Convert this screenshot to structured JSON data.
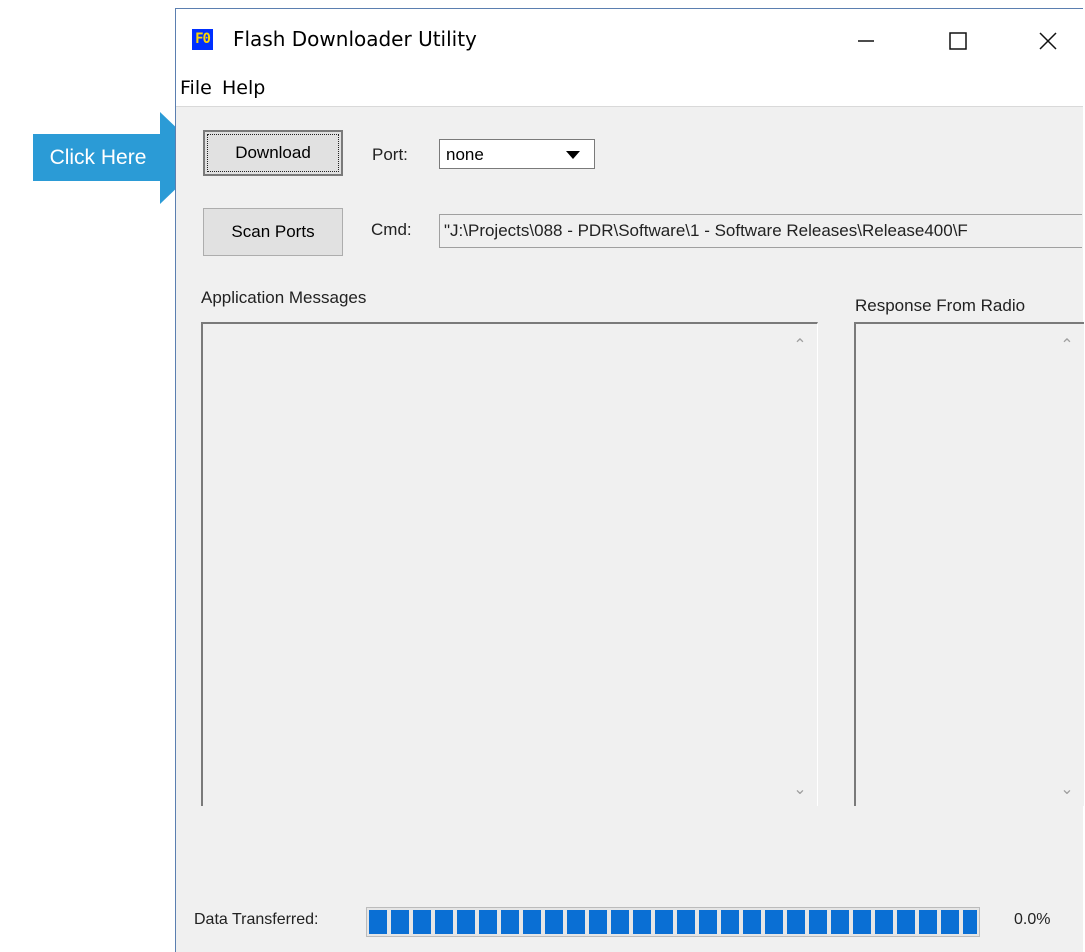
{
  "callout": {
    "label": "Click Here",
    "color": "#2b9bd6"
  },
  "window": {
    "title": "Flash Downloader Utility",
    "icon_glyph": "F0",
    "controls": {
      "minimize": "minimize-icon",
      "maximize": "maximize-icon",
      "close": "close-icon"
    }
  },
  "menu": {
    "file": "File",
    "help": "Help"
  },
  "toolbar": {
    "download_label": "Download",
    "scan_label": "Scan Ports",
    "port_label": "Port:",
    "port_value": "none",
    "cmd_label": "Cmd:",
    "cmd_value": "\"J:\\Projects\\088 - PDR\\Software\\1 - Software Releases\\Release400\\F"
  },
  "panels": {
    "app_messages_label": "Application Messages",
    "app_messages_text": "",
    "response_label": "Response From Radio",
    "response_text": ""
  },
  "progress": {
    "label": "Data Transferred:",
    "percent_text": "0.0%",
    "fill_fraction": 1.0,
    "color": "#0a6fd4"
  }
}
